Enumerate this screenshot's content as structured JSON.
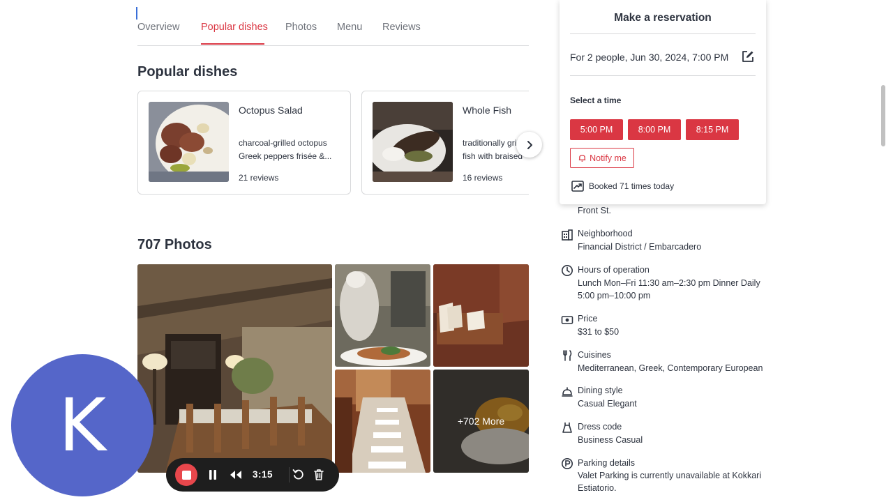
{
  "tabs": [
    {
      "label": "Overview"
    },
    {
      "label": "Popular dishes"
    },
    {
      "label": "Photos"
    },
    {
      "label": "Menu"
    },
    {
      "label": "Reviews"
    }
  ],
  "popular_dishes": {
    "title": "Popular dishes",
    "dishes": [
      {
        "name": "Octopus Salad",
        "desc_line1": "charcoal-grilled octopus",
        "desc_line2": "Greek peppers frisée &...",
        "reviews": "21 reviews"
      },
      {
        "name": "Whole Fish",
        "desc_line1": "traditionally grilled",
        "desc_line2": "fish with braised",
        "reviews": "16 reviews"
      }
    ]
  },
  "photos": {
    "title": "707 Photos",
    "more_label": "+702 More"
  },
  "reservation": {
    "title": "Make a reservation",
    "party": "For 2 people, Jun 30, 2024, 7:00 PM",
    "select_label": "Select a time",
    "times": [
      "5:00 PM",
      "8:00 PM",
      "8:15 PM"
    ],
    "notify_label": "Notify me",
    "booked": "Booked 71 times today"
  },
  "details": {
    "address_partial": "Front St.",
    "neighborhood": {
      "title": "Neighborhood",
      "value": "Financial District / Embarcadero"
    },
    "hours": {
      "title": "Hours of operation",
      "line1": "Lunch Mon–Fri 11:30 am–2:30 pm Dinner Daily",
      "line2": "5:00 pm–10:00 pm"
    },
    "price": {
      "title": "Price",
      "value": "$31 to $50"
    },
    "cuisines": {
      "title": "Cuisines",
      "value": "Mediterranean, Greek, Contemporary European"
    },
    "dining_style": {
      "title": "Dining style",
      "value": "Casual Elegant"
    },
    "dress_code": {
      "title": "Dress code",
      "value": "Business Casual"
    },
    "parking": {
      "title": "Parking details",
      "line1": "Valet Parking is currently unavailable at Kokkari",
      "line2": "Estiatorio."
    }
  },
  "recorder": {
    "avatar_letter": "K",
    "time": "3:15"
  },
  "colors": {
    "accent": "#da3743",
    "text": "#2d333f",
    "avatar": "#5566c9"
  }
}
